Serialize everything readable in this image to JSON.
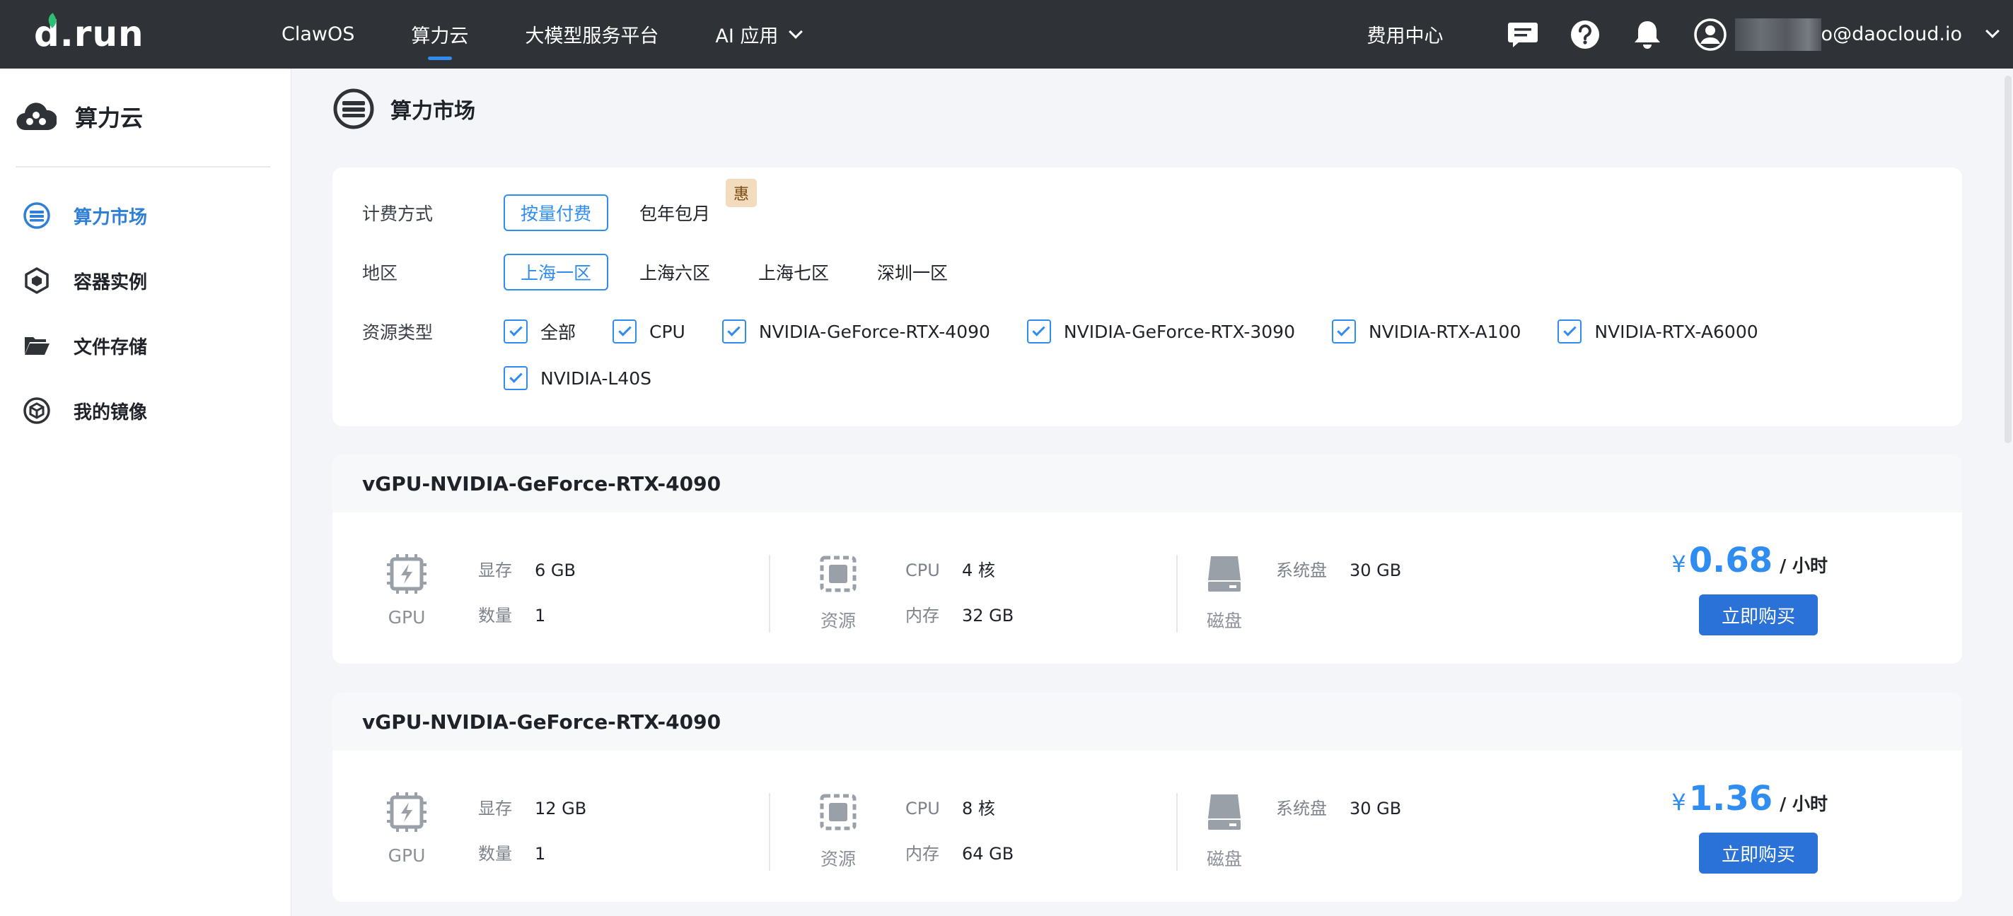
{
  "brand": {
    "logo_text": "d.run"
  },
  "topnav": {
    "items": [
      {
        "label": "ClawOS"
      },
      {
        "label": "算力云"
      },
      {
        "label": "大模型服务平台"
      },
      {
        "label": "AI 应用"
      }
    ],
    "active_index": 1,
    "fee_center": "费用中心",
    "email_visible": "o@daocloud.io"
  },
  "sidebar": {
    "title": "算力云",
    "items": [
      {
        "label": "算力市场",
        "icon": "market-icon",
        "active": true
      },
      {
        "label": "容器实例",
        "icon": "container-icon"
      },
      {
        "label": "文件存储",
        "icon": "folder-icon"
      },
      {
        "label": "我的镜像",
        "icon": "image-icon"
      }
    ]
  },
  "page": {
    "title": "算力市场"
  },
  "filters": {
    "billing": {
      "label": "计费方式",
      "options": [
        "按量付费",
        "包年包月"
      ],
      "selected": "按量付费",
      "badge": "惠"
    },
    "region": {
      "label": "地区",
      "options": [
        "上海一区",
        "上海六区",
        "上海七区",
        "深圳一区"
      ],
      "selected": "上海一区"
    },
    "resource": {
      "label": "资源类型",
      "options": [
        "全部",
        "CPU",
        "NVIDIA-GeForce-RTX-4090",
        "NVIDIA-GeForce-RTX-3090",
        "NVIDIA-RTX-A100",
        "NVIDIA-RTX-A6000",
        "NVIDIA-L40S"
      ],
      "checked": [
        true,
        true,
        true,
        true,
        true,
        true,
        true
      ]
    }
  },
  "products": [
    {
      "name": "vGPU-NVIDIA-GeForce-RTX-4090",
      "gpu": {
        "caption": "GPU",
        "mem_label": "显存",
        "mem_value": "6 GB",
        "count_label": "数量",
        "count_value": "1"
      },
      "resource": {
        "caption": "资源",
        "cpu_label": "CPU",
        "cpu_value": "4 核",
        "ram_label": "内存",
        "ram_value": "32 GB"
      },
      "disk": {
        "caption": "磁盘",
        "sys_label": "系统盘",
        "sys_value": "30 GB"
      },
      "price": {
        "currency": "¥",
        "amount": "0.68",
        "unit": "/ 小时"
      },
      "buy_label": "立即购买"
    },
    {
      "name": "vGPU-NVIDIA-GeForce-RTX-4090",
      "gpu": {
        "caption": "GPU",
        "mem_label": "显存",
        "mem_value": "12 GB",
        "count_label": "数量",
        "count_value": "1"
      },
      "resource": {
        "caption": "资源",
        "cpu_label": "CPU",
        "cpu_value": "8 核",
        "ram_label": "内存",
        "ram_value": "64 GB"
      },
      "disk": {
        "caption": "磁盘",
        "sys_label": "系统盘",
        "sys_value": "30 GB"
      },
      "price": {
        "currency": "¥",
        "amount": "1.36",
        "unit": "/ 小时"
      },
      "buy_label": "立即购买"
    }
  ],
  "colors": {
    "topbar": "#2f3237",
    "accent": "#2f8cf0",
    "button": "#2a72d8",
    "badge": "#f3dcbe"
  }
}
